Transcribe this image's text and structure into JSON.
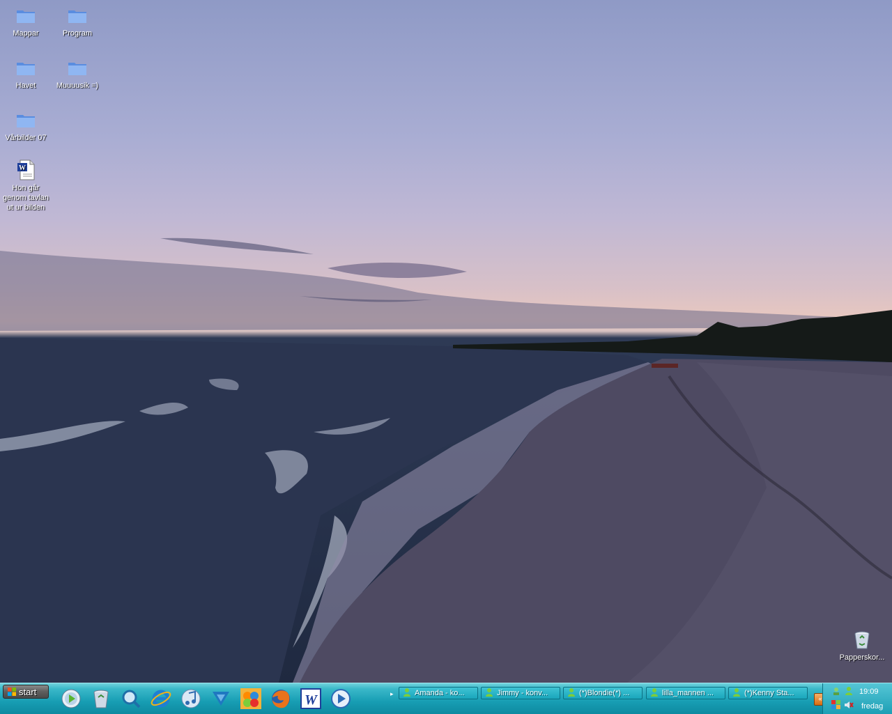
{
  "desktop": {
    "icons": [
      {
        "label": "Mappar",
        "icon": "folder-icon"
      },
      {
        "label": "Program",
        "icon": "folder-icon"
      },
      {
        "label": "Havet",
        "icon": "folder-icon"
      },
      {
        "label": "Muuuusik =)",
        "icon": "folder-icon"
      },
      {
        "label": "Vårbilder 07",
        "icon": "folder-icon"
      },
      {
        "label": "Hon går genom tavlan ut ur bilden",
        "icon": "word-document-icon"
      }
    ],
    "recycle_bin": {
      "label": "Papperskor...",
      "icon": "recycle-bin-icon"
    }
  },
  "taskbar": {
    "start_label": "start",
    "quick_launch": [
      "media-player-classic-icon",
      "recycle-icon",
      "search-icon",
      "internet-explorer-icon",
      "itunes-icon",
      "arrow-download-icon",
      "msn-icon",
      "firefox-icon",
      "word-icon",
      "windows-media-player-icon"
    ],
    "tasks": [
      {
        "label": "Amanda - ko..."
      },
      {
        "label": "Jimmy - konv..."
      },
      {
        "label": "(*)Blondie(*) ..."
      },
      {
        "label": "lilla_mannen ..."
      },
      {
        "label": "(*)Kenny Sta..."
      }
    ],
    "tray": {
      "expand_label": "«",
      "time": "19:09",
      "day": "fredag"
    }
  },
  "colors": {
    "taskbar": "#179db3",
    "sky_top": "#8f9ac6",
    "sky_horizon": "#e9c8bf",
    "sea": "#1f2940"
  }
}
